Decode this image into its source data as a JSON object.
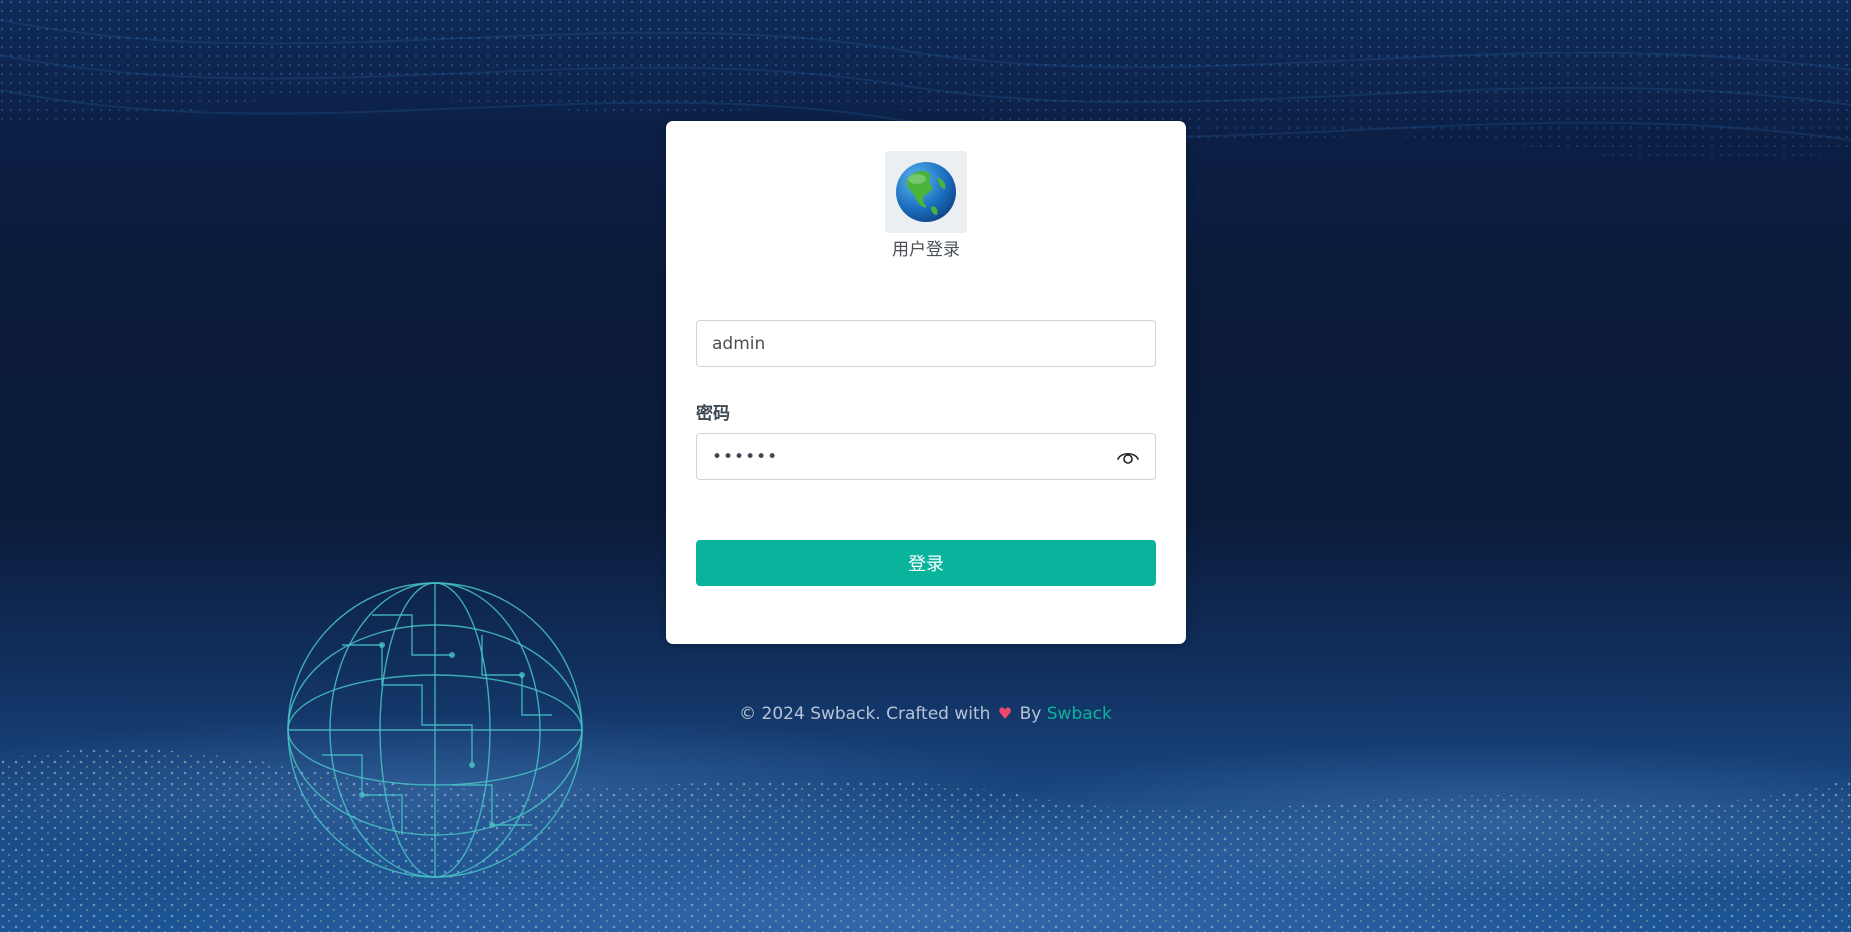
{
  "colors": {
    "primary": "#0ab39c",
    "heart": "#f0476e",
    "card": "#ffffff",
    "background_dark": "#0a1a38",
    "background_light": "#1c5594"
  },
  "logo": {
    "icon": "globe-logo-icon"
  },
  "card": {
    "title": "用户登录"
  },
  "username": {
    "value": "admin",
    "placeholder": ""
  },
  "password": {
    "label": "密码",
    "value": "••••••",
    "toggle_icon": "eye-icon"
  },
  "login": {
    "button_label": "登录"
  },
  "footer": {
    "prefix": "© 2024 Swback. Crafted with",
    "heart_icon": "heart-icon",
    "by": "By",
    "link_text": "Swback"
  }
}
